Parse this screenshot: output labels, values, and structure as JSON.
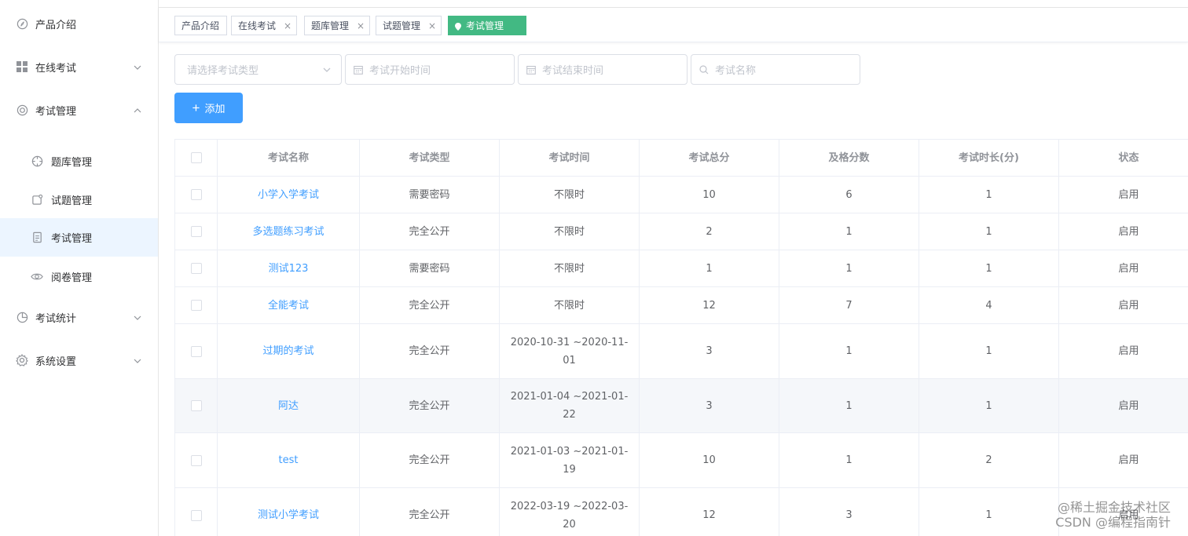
{
  "sidebar": {
    "items": [
      {
        "label": "产品介绍",
        "icon": "compass-icon"
      },
      {
        "label": "在线考试",
        "icon": "grid-icon"
      },
      {
        "label": "考试管理",
        "icon": "ring-icon"
      },
      {
        "label": "题库管理",
        "icon": "target-icon"
      },
      {
        "label": "试题管理",
        "icon": "note-icon"
      },
      {
        "label": "考试管理",
        "icon": "document-icon"
      },
      {
        "label": "阅卷管理",
        "icon": "eye-icon"
      },
      {
        "label": "考试统计",
        "icon": "pie-chart-icon"
      },
      {
        "label": "系统设置",
        "icon": "gear-icon"
      }
    ],
    "active_item": "考试管理"
  },
  "tags": [
    {
      "label": "产品介绍",
      "closable": false
    },
    {
      "label": "在线考试",
      "closable": true
    },
    {
      "label": "题库管理",
      "closable": true
    },
    {
      "label": "试题管理",
      "closable": true
    },
    {
      "label": "考试管理",
      "closable": false,
      "active": true
    }
  ],
  "tag_close_glyph": "×",
  "filters": {
    "type_placeholder": "请选择考试类型",
    "start_placeholder": "考试开始时间",
    "end_placeholder": "考试结束时间",
    "name_placeholder": "考试名称"
  },
  "add_button": {
    "icon": "plus-icon",
    "label": "添加"
  },
  "table": {
    "columns": [
      "考试名称",
      "考试类型",
      "考试时间",
      "考试总分",
      "及格分数",
      "考试时长(分)",
      "状态"
    ],
    "rows": [
      {
        "name": "小学入学考试",
        "type": "需要密码",
        "time": "不限时",
        "total": "10",
        "pass": "6",
        "duration": "1",
        "status": "启用"
      },
      {
        "name": "多选题练习考试",
        "type": "完全公开",
        "time": "不限时",
        "total": "2",
        "pass": "1",
        "duration": "1",
        "status": "启用"
      },
      {
        "name": "测试123",
        "type": "需要密码",
        "time": "不限时",
        "total": "1",
        "pass": "1",
        "duration": "1",
        "status": "启用"
      },
      {
        "name": "全能考试",
        "type": "完全公开",
        "time": "不限时",
        "total": "12",
        "pass": "7",
        "duration": "4",
        "status": "启用"
      },
      {
        "name": "过期的考试",
        "type": "完全公开",
        "time": "2020-10-31 ~2020-11-01",
        "total": "3",
        "pass": "1",
        "duration": "1",
        "status": "启用"
      },
      {
        "name": "阿达",
        "type": "完全公开",
        "time": "2021-01-04 ~2021-01-22",
        "total": "3",
        "pass": "1",
        "duration": "1",
        "status": "启用"
      },
      {
        "name": "test",
        "type": "完全公开",
        "time": "2021-01-03 ~2021-01-19",
        "total": "10",
        "pass": "1",
        "duration": "2",
        "status": "启用"
      },
      {
        "name": "测试小学考试",
        "type": "完全公开",
        "time": "2022-03-19 ~2022-03-20",
        "total": "12",
        "pass": "3",
        "duration": "1",
        "status": "启用"
      }
    ]
  },
  "watermark": {
    "line1": "@稀土掘金技术社区",
    "line2": "CSDN @编程指南针"
  },
  "colors": {
    "primary": "#409eff",
    "tag_active": "#42b983",
    "menu_active_bg": "#ecf5ff"
  }
}
